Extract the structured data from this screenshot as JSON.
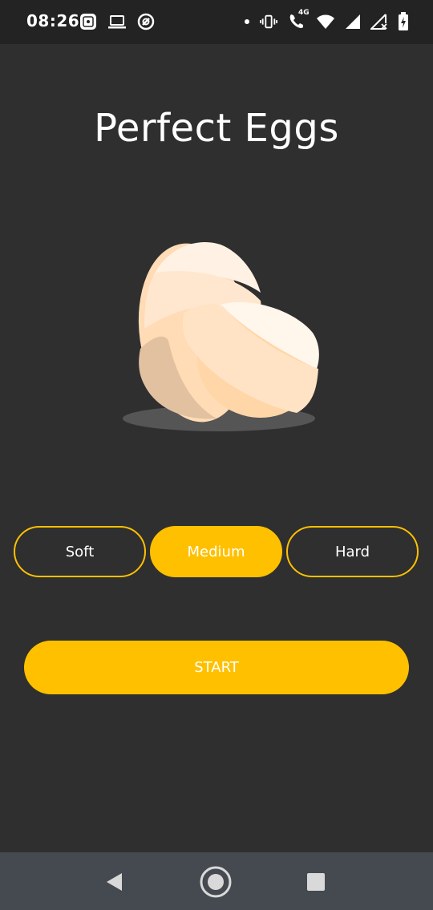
{
  "status_bar": {
    "time": "08:26",
    "network_label": "4G",
    "left_icons": [
      "screen-record-icon",
      "laptop-icon",
      "vpn-icon"
    ],
    "right_icons": [
      "dot-icon",
      "vibrate-icon",
      "wifi-calling-icon",
      "wifi-icon",
      "signal-icon",
      "signal-no-sim-icon",
      "battery-charging-icon"
    ]
  },
  "app": {
    "title": "Perfect Eggs",
    "illustration": "eggs-illustration",
    "options": [
      {
        "label": "Soft",
        "selected": false
      },
      {
        "label": "Medium",
        "selected": true
      },
      {
        "label": "Hard",
        "selected": false
      }
    ],
    "start_label": "START",
    "accent_color": "#ffc000",
    "background_color": "#2f2f2f"
  },
  "nav_bar": {
    "icons": [
      "back-icon",
      "home-icon",
      "recents-icon"
    ]
  }
}
